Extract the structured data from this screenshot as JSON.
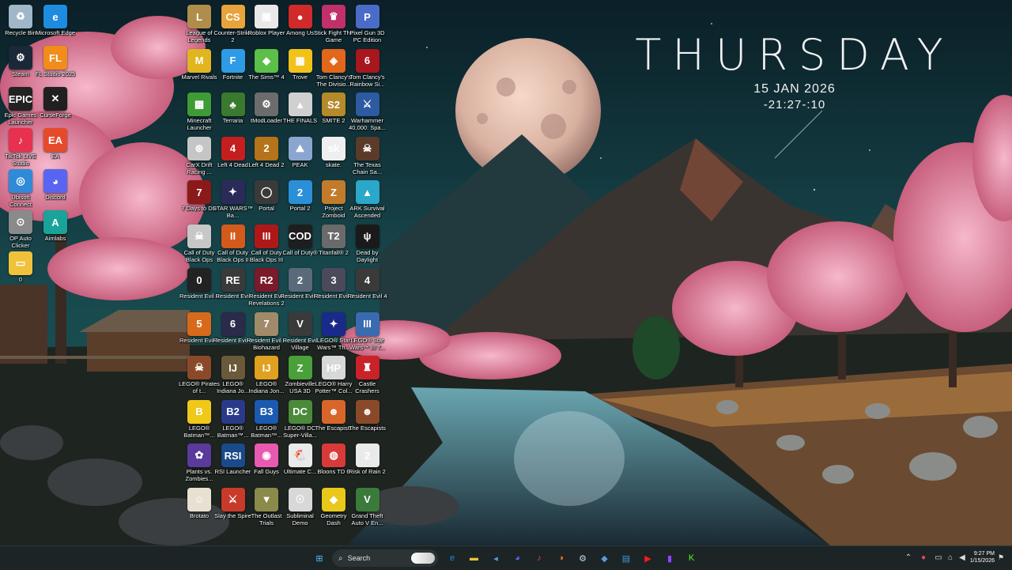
{
  "clock": {
    "day": "THURSDAY",
    "date": "15 JAN 2026",
    "time": "-21:27-:10"
  },
  "desktop_icons": [
    {
      "label": "Recycle Bin",
      "icon": "recycle-bin-icon",
      "color": "#9fb7c8",
      "glyph": "♻"
    },
    {
      "label": "Microsoft Edge",
      "icon": "edge-icon",
      "color": "#1d8ce0",
      "glyph": "e"
    },
    {
      "label": "Steam",
      "icon": "steam-icon",
      "color": "#1b2838",
      "glyph": "⚙"
    },
    {
      "label": "FL Studio 2025",
      "icon": "fl-studio-icon",
      "color": "#f28c1b",
      "glyph": "FL"
    },
    {
      "label": "Epic Games Launcher",
      "icon": "epic-games-icon",
      "color": "#222",
      "glyph": "EPIC"
    },
    {
      "label": "CurseForge",
      "icon": "curseforge-icon",
      "color": "#202020",
      "glyph": "✕"
    },
    {
      "label": "TikTok LIVE Studio",
      "icon": "tiktok-icon",
      "color": "#e8314f",
      "glyph": "♪"
    },
    {
      "label": "EA",
      "icon": "ea-icon",
      "color": "#e54b2b",
      "glyph": "EA"
    },
    {
      "label": "Ubisoft Connect",
      "icon": "ubisoft-icon",
      "color": "#2f8ad8",
      "glyph": "◎"
    },
    {
      "label": "Discord",
      "icon": "discord-icon",
      "color": "#5865f2",
      "glyph": "◕"
    },
    {
      "label": "OP Auto Clicker",
      "icon": "op-auto-clicker-icon",
      "color": "#8a8a8a",
      "glyph": "⊙"
    },
    {
      "label": "Aimlabs",
      "icon": "aimlabs-icon",
      "color": "#1aa39a",
      "glyph": "A"
    },
    {
      "label": "0",
      "icon": "folder-icon",
      "color": "#f0c23b",
      "glyph": "▭"
    },
    {
      "label": "League of Legends",
      "icon": "league-icon",
      "color": "#b08d4a",
      "glyph": "L"
    },
    {
      "label": "Counter-Strike 2",
      "icon": "cs2-icon",
      "color": "#e8a33b",
      "glyph": "CS"
    },
    {
      "label": "Roblox Player",
      "icon": "roblox-icon",
      "color": "#e8e8e8",
      "glyph": "▣"
    },
    {
      "label": "Among Us",
      "icon": "among-us-icon",
      "color": "#d02a2a",
      "glyph": "●"
    },
    {
      "label": "Stick Fight The Game",
      "icon": "stick-fight-icon",
      "color": "#c0306a",
      "glyph": "♛"
    },
    {
      "label": "Pixel Gun 3D PC Edition",
      "icon": "pixel-gun-icon",
      "color": "#4a6cc8",
      "glyph": "P"
    },
    {
      "label": "Marvel Rivals",
      "icon": "marvel-rivals-icon",
      "color": "#e0b520",
      "glyph": "M"
    },
    {
      "label": "Fortnite",
      "icon": "fortnite-icon",
      "color": "#2e9be6",
      "glyph": "F"
    },
    {
      "label": "The Sims™ 4",
      "icon": "sims-icon",
      "color": "#5bbf4a",
      "glyph": "◆"
    },
    {
      "label": "Trove",
      "icon": "trove-icon",
      "color": "#f2c21b",
      "glyph": "▦"
    },
    {
      "label": "Tom Clancy's The Divisio...",
      "icon": "division-icon",
      "color": "#e2661b",
      "glyph": "◈"
    },
    {
      "label": "Tom Clancy's Rainbow Si...",
      "icon": "rainbow-six-icon",
      "color": "#a8161e",
      "glyph": "6"
    },
    {
      "label": "Minecraft Launcher",
      "icon": "minecraft-icon",
      "color": "#3f9b35",
      "glyph": "▩"
    },
    {
      "label": "Terraria",
      "icon": "terraria-icon",
      "color": "#3a7a2e",
      "glyph": "♣"
    },
    {
      "label": "tModLoader",
      "icon": "tmodloader-icon",
      "color": "#6c6c6c",
      "glyph": "⚙"
    },
    {
      "label": "THE FINALS",
      "icon": "the-finals-icon",
      "color": "#d0d0d0",
      "glyph": "▲"
    },
    {
      "label": "SMITE 2",
      "icon": "smite-icon",
      "color": "#b58a2a",
      "glyph": "S2"
    },
    {
      "label": "Warhammer 40,000: Spa...",
      "icon": "warhammer-icon",
      "color": "#2d5aa0",
      "glyph": "⚔"
    },
    {
      "label": "CarX Drift Racing ...",
      "icon": "carx-icon",
      "color": "#c5c5c5",
      "glyph": "⊛"
    },
    {
      "label": "Left 4 Dead",
      "icon": "left4dead-icon",
      "color": "#c41f1f",
      "glyph": "4"
    },
    {
      "label": "Left 4 Dead 2",
      "icon": "left4dead2-icon",
      "color": "#b5731a",
      "glyph": "2"
    },
    {
      "label": "PEAK",
      "icon": "peak-icon",
      "color": "#8aa6d0",
      "glyph": "⛰"
    },
    {
      "label": "skate.",
      "icon": "skate-icon",
      "color": "#efefef",
      "glyph": "sk"
    },
    {
      "label": "The Texas Chain Sa...",
      "icon": "texas-chainsaw-icon",
      "color": "#5a3b2a",
      "glyph": "☠"
    },
    {
      "label": "7 Days to Die",
      "icon": "seven-days-icon",
      "color": "#8a1a1a",
      "glyph": "7"
    },
    {
      "label": "STAR WARS™ Ba...",
      "icon": "star-wars-icon",
      "color": "#2b2b5a",
      "glyph": "✦"
    },
    {
      "label": "Portal",
      "icon": "portal-icon",
      "color": "#3a3a3a",
      "glyph": "◯"
    },
    {
      "label": "Portal 2",
      "icon": "portal2-icon",
      "color": "#2b8fd8",
      "glyph": "2"
    },
    {
      "label": "Project Zomboid",
      "icon": "zomboid-icon",
      "color": "#c27b2a",
      "glyph": "Z"
    },
    {
      "label": "ARK Survival Ascended",
      "icon": "ark-icon",
      "color": "#2aa7c9",
      "glyph": "▲"
    },
    {
      "label": "Call of Duty Black Ops",
      "icon": "cod-bo-icon",
      "color": "#c7c7c7",
      "glyph": "☠"
    },
    {
      "label": "Call of Duty Black Ops II",
      "icon": "cod-bo2-icon",
      "color": "#d35a1b",
      "glyph": "II"
    },
    {
      "label": "Call of Duty Black Ops III",
      "icon": "cod-bo3-icon",
      "color": "#b01818",
      "glyph": "III"
    },
    {
      "label": "Call of Duty®",
      "icon": "cod-icon",
      "color": "#1e1e1e",
      "glyph": "COD"
    },
    {
      "label": "Titanfall® 2",
      "icon": "titanfall-icon",
      "color": "#6a6a6a",
      "glyph": "T2"
    },
    {
      "label": "Dead by Daylight",
      "icon": "dbd-icon",
      "color": "#1a1a1a",
      "glyph": "ψ"
    },
    {
      "label": "Resident Evil 0",
      "icon": "re0-icon",
      "color": "#222",
      "glyph": "0"
    },
    {
      "label": "Resident Evil",
      "icon": "re-icon",
      "color": "#3a3a3a",
      "glyph": "RE"
    },
    {
      "label": "Resident Evil Revelations 2",
      "icon": "re-rev2-icon",
      "color": "#7a1a2a",
      "glyph": "R2"
    },
    {
      "label": "Resident Evil 2",
      "icon": "re2-icon",
      "color": "#5a6a7a",
      "glyph": "2"
    },
    {
      "label": "Resident Evil 3",
      "icon": "re3-icon",
      "color": "#4a4a5a",
      "glyph": "3"
    },
    {
      "label": "Resident Evil 4",
      "icon": "re4-icon",
      "color": "#3a3a3a",
      "glyph": "4"
    },
    {
      "label": "Resident Evil 5",
      "icon": "re5-icon",
      "color": "#d66a1a",
      "glyph": "5"
    },
    {
      "label": "Resident Evil 6",
      "icon": "re6-icon",
      "color": "#2a2a4a",
      "glyph": "6"
    },
    {
      "label": "Resident Evil 7 Biohazard",
      "icon": "re7-icon",
      "color": "#a08a6a",
      "glyph": "7"
    },
    {
      "label": "Resident Evil Village",
      "icon": "re-village-icon",
      "color": "#3a3a3a",
      "glyph": "V"
    },
    {
      "label": "LEGO® Star Wars™ Th...",
      "icon": "lego-sw-icon",
      "color": "#1a2a8a",
      "glyph": "✦"
    },
    {
      "label": "LEGO® Star Wars™ III T...",
      "icon": "lego-sw3-icon",
      "color": "#3a6ab0",
      "glyph": "III"
    },
    {
      "label": "LEGO® Pirates of t...",
      "icon": "lego-pirates-icon",
      "color": "#8a4a2a",
      "glyph": "☠"
    },
    {
      "label": "LEGO® Indiana Jo...",
      "icon": "lego-indy-icon",
      "color": "#6a5a3a",
      "glyph": "IJ"
    },
    {
      "label": "LEGO® Indiana Jon...",
      "icon": "lego-indy2-icon",
      "color": "#e0a020",
      "glyph": "IJ"
    },
    {
      "label": "Zombieville USA 3D",
      "icon": "zombieville-icon",
      "color": "#4aa03a",
      "glyph": "Z"
    },
    {
      "label": "LEGO® Harry Potter™ Col...",
      "icon": "lego-hp-icon",
      "color": "#d8d8d8",
      "glyph": "HP"
    },
    {
      "label": "Castle Crashers",
      "icon": "castle-crashers-icon",
      "color": "#c8222a",
      "glyph": "♜"
    },
    {
      "label": "LEGO® Batman™...",
      "icon": "lego-batman-icon",
      "color": "#f0c81a",
      "glyph": "B"
    },
    {
      "label": "LEGO® Batman™...",
      "icon": "lego-batman2-icon",
      "color": "#2a3a8a",
      "glyph": "B2"
    },
    {
      "label": "LEGO® Batman™...",
      "icon": "lego-batman3-icon",
      "color": "#1a5ab0",
      "glyph": "B3"
    },
    {
      "label": "LEGO® DC Super-Villa...",
      "icon": "lego-dc-icon",
      "color": "#4a8a3a",
      "glyph": "DC"
    },
    {
      "label": "The Escapists",
      "icon": "escapists-icon",
      "color": "#d8662a",
      "glyph": "☻"
    },
    {
      "label": "The Escapists",
      "icon": "escapists2-icon",
      "color": "#8a4a2a",
      "glyph": "☻"
    },
    {
      "label": "Plants vs. Zombies...",
      "icon": "pvz-icon",
      "color": "#5a3a9a",
      "glyph": "✿"
    },
    {
      "label": "RSI Launcher",
      "icon": "rsi-icon",
      "color": "#1a4a8a",
      "glyph": "RSI"
    },
    {
      "label": "Fall Guys",
      "icon": "fall-guys-icon",
      "color": "#e85ab0",
      "glyph": "◉"
    },
    {
      "label": "Ultimate C...",
      "icon": "ultimate-chicken-icon",
      "color": "#eaeaea",
      "glyph": "🐔"
    },
    {
      "label": "Bloons TD 6",
      "icon": "bloons-icon",
      "color": "#d83a3a",
      "glyph": "◍"
    },
    {
      "label": "Risk of Rain 2",
      "icon": "risk-of-rain-icon",
      "color": "#eaeaea",
      "glyph": "2"
    },
    {
      "label": "Brotato",
      "icon": "brotato-icon",
      "color": "#e8e0d0",
      "glyph": "☺"
    },
    {
      "label": "Slay the Spire",
      "icon": "slay-spire-icon",
      "color": "#c83a2a",
      "glyph": "⚔"
    },
    {
      "label": "The Outlast Trials",
      "icon": "outlast-icon",
      "color": "#8a8a4a",
      "glyph": "▼"
    },
    {
      "label": "Subliminal Demo",
      "icon": "subliminal-icon",
      "color": "#d8d8d8",
      "glyph": "☉"
    },
    {
      "label": "Geometry Dash",
      "icon": "geometry-dash-icon",
      "color": "#e8c81a",
      "glyph": "◆"
    },
    {
      "label": "Grand Theft Auto V En...",
      "icon": "gta-icon",
      "color": "#3a7a3a",
      "glyph": "V"
    }
  ],
  "taskbar": {
    "search_label": "Search",
    "apps": [
      {
        "name": "windows-start-icon",
        "glyph": "⊞",
        "color": "#4cc2ff"
      },
      {
        "name": "edge-taskbar-icon",
        "glyph": "e",
        "color": "#1d8ce0"
      },
      {
        "name": "file-explorer-icon",
        "glyph": "▬",
        "color": "#f0c23b"
      },
      {
        "name": "visual-studio-icon",
        "glyph": "◂",
        "color": "#5a9ad8"
      },
      {
        "name": "discord-taskbar-icon",
        "glyph": "◕",
        "color": "#5865f2"
      },
      {
        "name": "music-app-icon",
        "glyph": "♪",
        "color": "#fa3a5a"
      },
      {
        "name": "firefox-icon",
        "glyph": "◑",
        "color": "#ff7a1a"
      },
      {
        "name": "steam-taskbar-icon",
        "glyph": "⚙",
        "color": "#c8d8e8"
      },
      {
        "name": "code-editor-icon",
        "glyph": "◆",
        "color": "#5a9ad8"
      },
      {
        "name": "notepad-icon",
        "glyph": "▤",
        "color": "#3a9ad8"
      },
      {
        "name": "youtube-icon",
        "glyph": "▶",
        "color": "#ff1a1a"
      },
      {
        "name": "twitch-icon",
        "glyph": "▮",
        "color": "#9146ff"
      },
      {
        "name": "kick-icon",
        "glyph": "K",
        "color": "#53fc18"
      }
    ],
    "tray_time": "9:27 PM",
    "tray_date": "1/15/2026"
  }
}
